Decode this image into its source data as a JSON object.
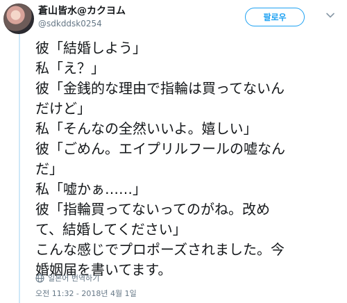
{
  "tweet": {
    "author": {
      "display_name": "蒼山皆水@カクヨム",
      "handle": "@sdkddsk0254"
    },
    "follow_button_label": "팔로우",
    "lines": [
      "彼「結婚しよう」",
      "私「え？」",
      "彼「金銭的な理由で指輪は買ってないん",
      "だけど」",
      "私「そんなの全然いいよ。嬉しい」",
      "彼「ごめん。エイプリルフールの嘘なん",
      "だ」",
      "私「嘘かぁ……」",
      "彼「指輪買ってないってのがね。改め",
      "て、結婚してください」",
      "こんな感じでプロポーズされました。今",
      "婚姻届を書いてます。"
    ],
    "translate_label": "일본어 번역하기",
    "timestamp": "오전 11:32 - 2018년 4월 1일",
    "icons": {
      "more": "chevron-down-icon",
      "translate": "globe-icon"
    },
    "colors": {
      "accent": "#1da1f2",
      "secondary_text": "#657786",
      "text": "#14171a"
    }
  }
}
